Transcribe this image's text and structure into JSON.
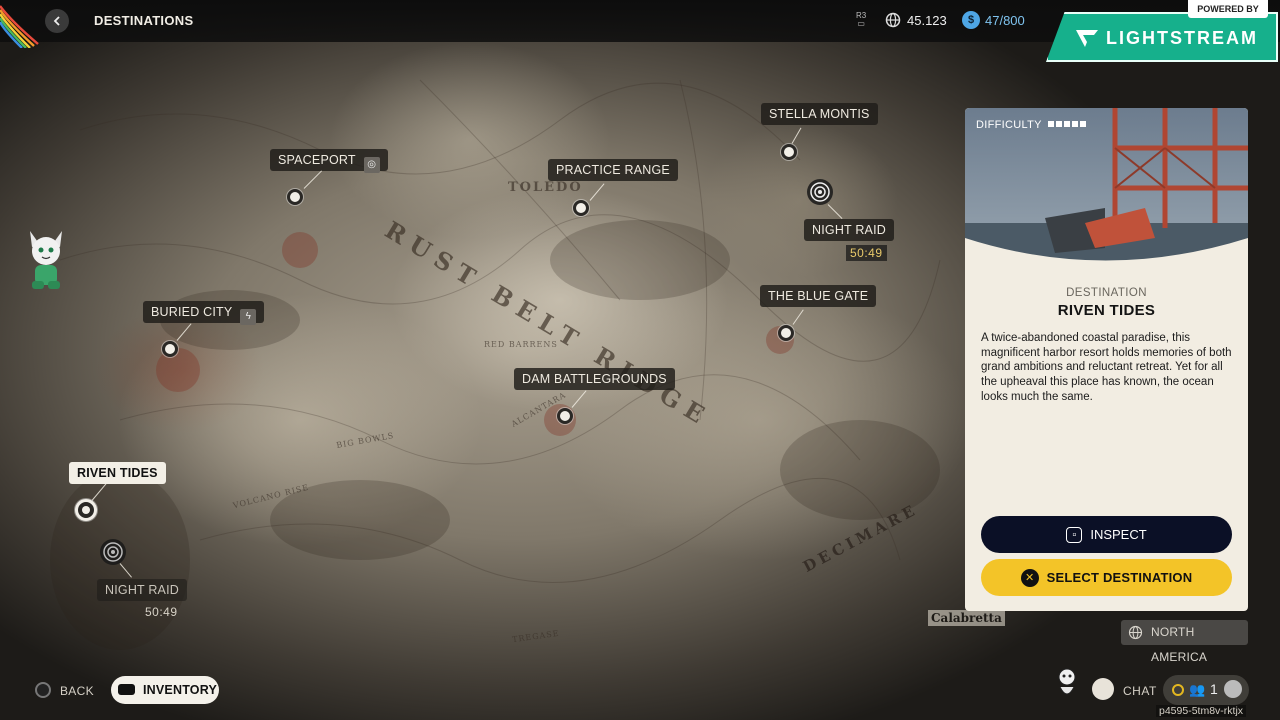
{
  "header": {
    "title": "DESTINATIONS",
    "r3_badge": "R3",
    "currency_value": "45.123",
    "capacity_value": "47/800",
    "capacity_icon_glyph": "$"
  },
  "overlay": {
    "powered_by": "POWERED BY",
    "brand": "LIGHTSTREAM",
    "brand_color": "#16b08c"
  },
  "map": {
    "region_text": "RUST BELT RIDGE",
    "sea_text": "DECIMARE",
    "town_text": "TOLEDO",
    "corner_text": "Calabretta",
    "minor_labels": [
      "BIG BOWLS",
      "VOLCANO RISE",
      "ALCANTARA",
      "RED BARRENS",
      "TREGASE"
    ],
    "locations": [
      {
        "id": "spaceport",
        "label": "SPACEPORT",
        "icon": "target-icon"
      },
      {
        "id": "practice_range",
        "label": "PRACTICE RANGE"
      },
      {
        "id": "stella_montis",
        "label": "STELLA MONTIS"
      },
      {
        "id": "buried_city",
        "label": "BURIED CITY",
        "icon": "lightning-icon"
      },
      {
        "id": "the_blue_gate",
        "label": "THE BLUE GATE"
      },
      {
        "id": "dam_battlegrounds",
        "label": "DAM BATTLEGROUNDS"
      },
      {
        "id": "riven_tides",
        "label": "RIVEN TIDES",
        "selected": true
      }
    ],
    "events": [
      {
        "label": "NIGHT RAID",
        "timer": "50:49"
      },
      {
        "label": "NIGHT RAID",
        "timer": "50:49"
      }
    ]
  },
  "panel": {
    "difficulty_label": "DIFFICULTY",
    "difficulty_level": 1,
    "difficulty_max": 5,
    "kicker": "DESTINATION",
    "name": "RIVEN TIDES",
    "description": "A twice-abandoned coastal paradise, this magnificent harbor resort holds memories of both grand ambitions and reluctant retreat. Yet for all the upheaval this place has known, the ocean looks much the same.",
    "inspect_label": "INSPECT",
    "select_label": "SELECT DESTINATION",
    "select_color": "#f3c428"
  },
  "region": {
    "label": "NORTH AMERICA"
  },
  "footer": {
    "back_label": "BACK",
    "inventory_label": "INVENTORY",
    "chat_label": "CHAT",
    "party_count": "1",
    "session_id": "p4595-5tm8v-rktjx"
  }
}
